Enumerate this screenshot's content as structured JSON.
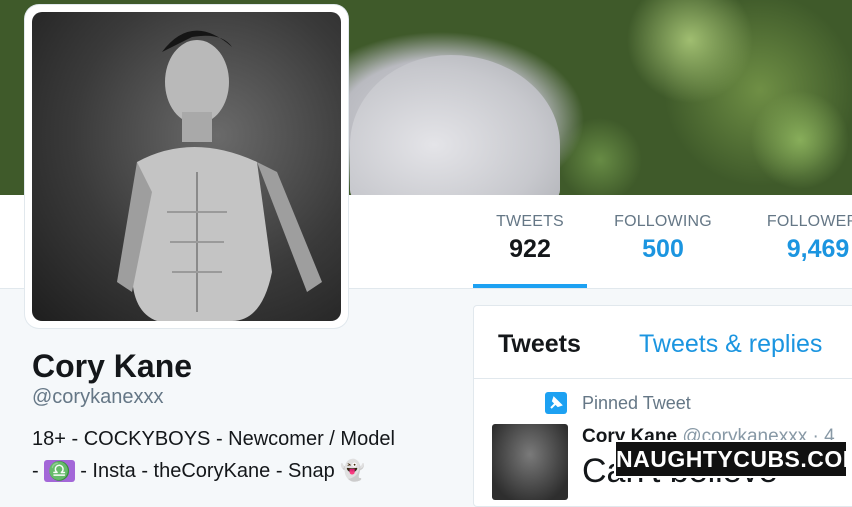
{
  "stats": [
    {
      "label": "TWEETS",
      "value": "922"
    },
    {
      "label": "FOLLOWING",
      "value": "500"
    },
    {
      "label": "FOLLOWERS",
      "value": "9,469"
    }
  ],
  "profile": {
    "name": "Cory Kane",
    "handle": "@corykanexxx",
    "bio_line1": "18+ - COCKYBOYS - Newcomer / Model",
    "bio_line2_prefix": "- ",
    "bio_zodiac": "♎",
    "bio_line2_suffix": " - Insta - theCoryKane - Snap 👻"
  },
  "tweets_card": {
    "tab_tweets": "Tweets",
    "tab_replies": "Tweets & replies",
    "pinned_label": "Pinned Tweet",
    "author_name": "Cory Kane",
    "author_handle": "@corykanexxx · 4",
    "tweet_text": "Can't believe"
  },
  "watermark": "NAUGHTYCUBS.COM",
  "colors": {
    "accent": "#1da1f2",
    "link": "#1b95e0"
  }
}
